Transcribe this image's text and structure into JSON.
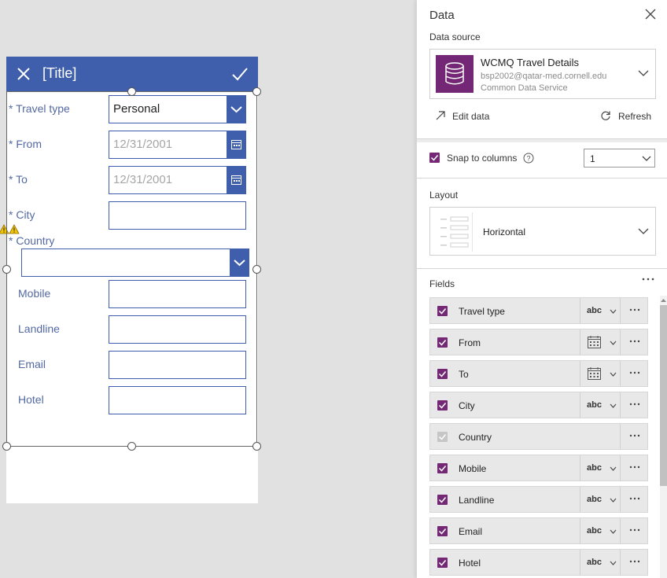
{
  "form": {
    "title": "[Title]",
    "fields": [
      {
        "label": "* Travel type",
        "value": "Personal",
        "kind": "dropdown"
      },
      {
        "label": "* From",
        "value": "12/31/2001",
        "kind": "date"
      },
      {
        "label": "* To",
        "value": "12/31/2001",
        "kind": "date"
      },
      {
        "label": "* City",
        "value": "",
        "kind": "text"
      }
    ],
    "country_label": "* Country",
    "extra_fields": [
      {
        "label": "Mobile",
        "value": ""
      },
      {
        "label": "Landline",
        "value": ""
      },
      {
        "label": "Email",
        "value": ""
      },
      {
        "label": "Hotel",
        "value": ""
      }
    ],
    "colors": {
      "header": "#3f5fad",
      "label": "#5469a3"
    }
  },
  "panel": {
    "title": "Data",
    "data_source_label": "Data source",
    "data_source": {
      "name": "WCMQ Travel Details",
      "account": "bsp2002@qatar-med.cornell.edu",
      "service": "Common Data Service",
      "icon": "database-icon"
    },
    "edit_data": "Edit data",
    "refresh": "Refresh",
    "snap_to_columns": "Snap to columns",
    "snap_checked": true,
    "columns_value": "1",
    "layout_label": "Layout",
    "layout_value": "Horizontal",
    "fields_label": "Fields",
    "field_list": [
      {
        "name": "Travel type",
        "control": "abc",
        "checked": true
      },
      {
        "name": "From",
        "control": "calendar",
        "checked": true
      },
      {
        "name": "To",
        "control": "calendar",
        "checked": true
      },
      {
        "name": "City",
        "control": "abc",
        "checked": true
      },
      {
        "name": "Country",
        "control": "",
        "checked": true,
        "disabled": true
      },
      {
        "name": "Mobile",
        "control": "abc",
        "checked": true
      },
      {
        "name": "Landline",
        "control": "abc",
        "checked": true
      },
      {
        "name": "Email",
        "control": "abc",
        "checked": true
      },
      {
        "name": "Hotel",
        "control": "abc",
        "checked": true
      }
    ],
    "accent": "#742774"
  }
}
